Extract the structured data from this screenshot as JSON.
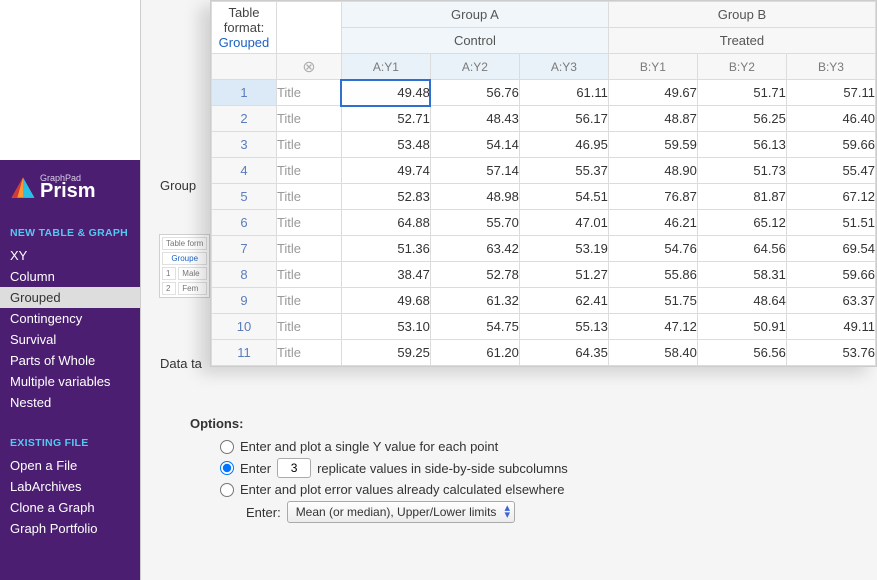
{
  "brand": {
    "small": "GraphPad",
    "big": "Prism"
  },
  "sidebar": {
    "section_new": "NEW TABLE & GRAPH",
    "items_new": [
      "XY",
      "Column",
      "Grouped",
      "Contingency",
      "Survival",
      "Parts of Whole",
      "Multiple variables",
      "Nested"
    ],
    "selected_new": 2,
    "section_existing": "EXISTING FILE",
    "items_existing": [
      "Open a File",
      "LabArchives",
      "Clone a Graph",
      "Graph Portfolio"
    ]
  },
  "dialog": {
    "group_label": "Group",
    "data_label": "Data ta",
    "options_heading": "Options:",
    "opt_single": "Enter and plot a single Y value for each point",
    "opt_repl_before": "Enter",
    "opt_repl_n": "3",
    "opt_repl_after": "replicate values in side-by-side subcolumns",
    "opt_error": "Enter and plot error values already calculated elsewhere",
    "enter_label": "Enter:",
    "enter_select": "Mean (or median), Upper/Lower limits",
    "mini": {
      "fmt": "Table form",
      "link": "Groupe",
      "rows": [
        "Male",
        "Fem"
      ]
    }
  },
  "sheet": {
    "format_title": "Table format:",
    "format_link": "Grouped",
    "groupA": "Group A",
    "groupB": "Group B",
    "controlA": "Control",
    "controlB": "Treated",
    "sub": {
      "a": [
        "A:Y1",
        "A:Y2",
        "A:Y3"
      ],
      "b": [
        "B:Y1",
        "B:Y2",
        "B:Y3"
      ]
    },
    "row_title_placeholder": "Title",
    "rows": [
      {
        "n": "1",
        "a": [
          "49.48",
          "56.76",
          "61.11"
        ],
        "b": [
          "49.67",
          "51.71",
          "57.11"
        ]
      },
      {
        "n": "2",
        "a": [
          "52.71",
          "48.43",
          "56.17"
        ],
        "b": [
          "48.87",
          "56.25",
          "46.40"
        ]
      },
      {
        "n": "3",
        "a": [
          "53.48",
          "54.14",
          "46.95"
        ],
        "b": [
          "59.59",
          "56.13",
          "59.66"
        ]
      },
      {
        "n": "4",
        "a": [
          "49.74",
          "57.14",
          "55.37"
        ],
        "b": [
          "48.90",
          "51.73",
          "55.47"
        ]
      },
      {
        "n": "5",
        "a": [
          "52.83",
          "48.98",
          "54.51"
        ],
        "b": [
          "76.87",
          "81.87",
          "67.12"
        ]
      },
      {
        "n": "6",
        "a": [
          "64.88",
          "55.70",
          "47.01"
        ],
        "b": [
          "46.21",
          "65.12",
          "51.51"
        ]
      },
      {
        "n": "7",
        "a": [
          "51.36",
          "63.42",
          "53.19"
        ],
        "b": [
          "54.76",
          "64.56",
          "69.54"
        ]
      },
      {
        "n": "8",
        "a": [
          "38.47",
          "52.78",
          "51.27"
        ],
        "b": [
          "55.86",
          "58.31",
          "59.66"
        ]
      },
      {
        "n": "9",
        "a": [
          "49.68",
          "61.32",
          "62.41"
        ],
        "b": [
          "51.75",
          "48.64",
          "63.37"
        ]
      },
      {
        "n": "10",
        "a": [
          "53.10",
          "54.75",
          "55.13"
        ],
        "b": [
          "47.12",
          "50.91",
          "49.11"
        ]
      },
      {
        "n": "11",
        "a": [
          "59.25",
          "61.20",
          "64.35"
        ],
        "b": [
          "58.40",
          "56.56",
          "53.76"
        ]
      }
    ]
  }
}
